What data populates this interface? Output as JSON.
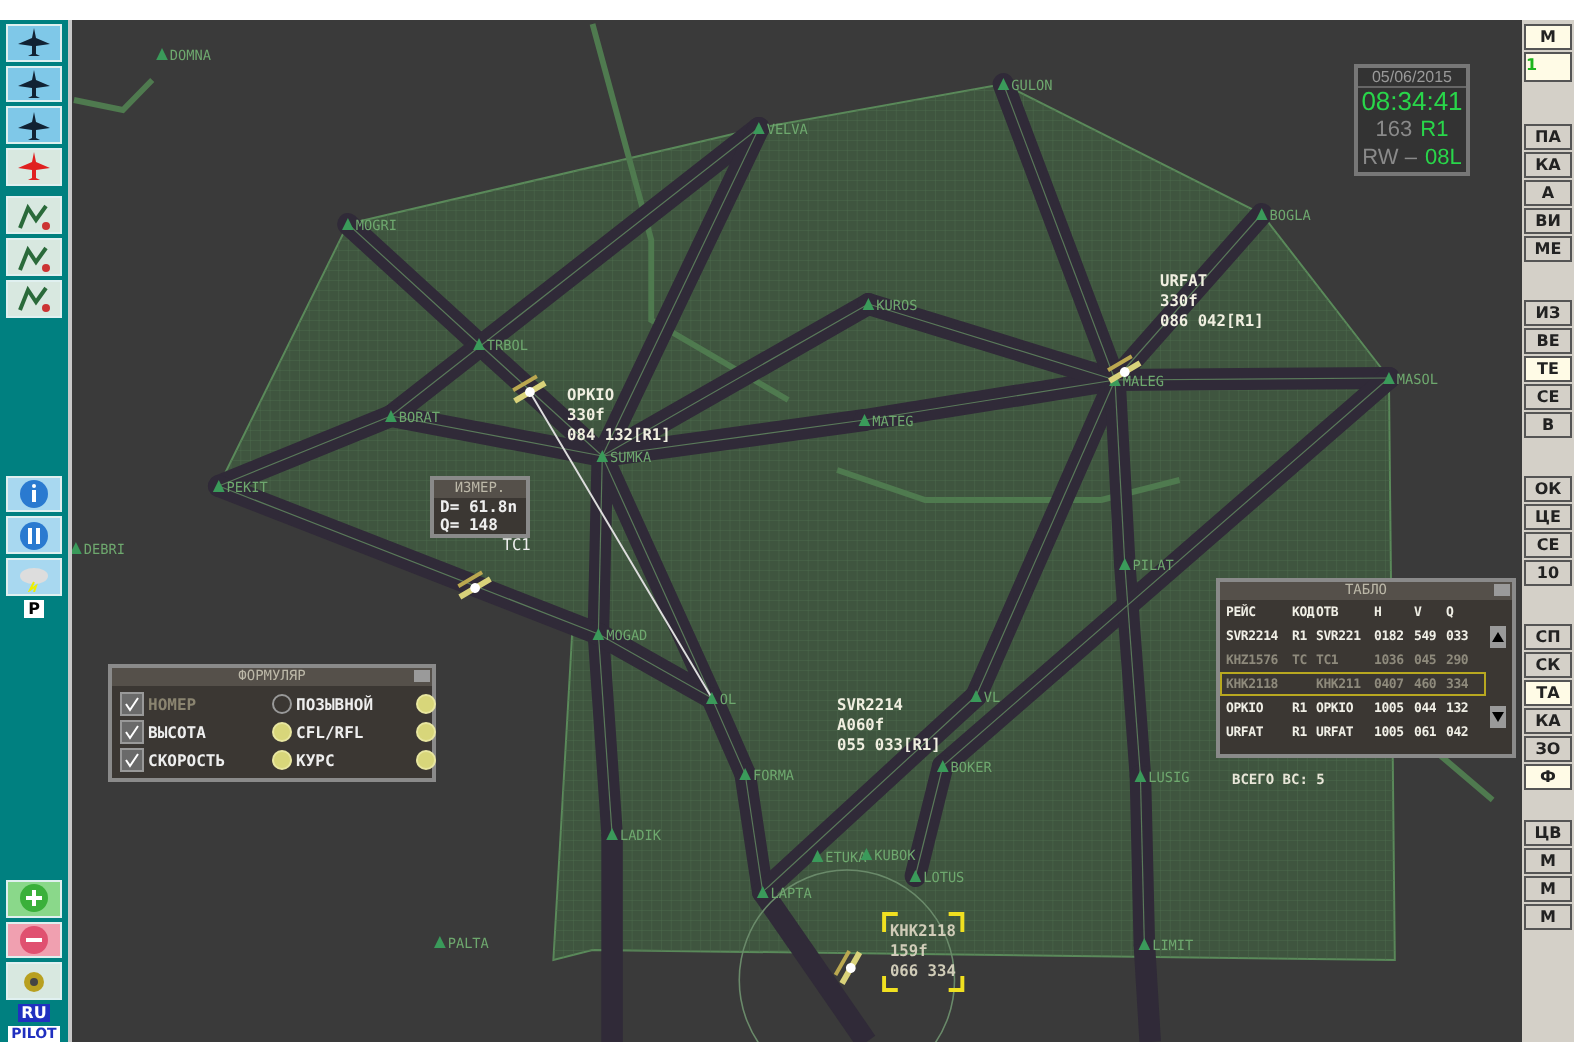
{
  "toolbar": {
    "weather_label": "P",
    "language": "RU",
    "pilot": "PILOT"
  },
  "map": {
    "waypoints": [
      "DOMNA",
      "VELVA",
      "MOGRI",
      "GULON",
      "BOGLA",
      "KUROS",
      "TRBOL",
      "BORAT",
      "MALEG",
      "MATEG",
      "MASOL",
      "SUMKA",
      "PEKIT",
      "DEBRI",
      "PILAT",
      "MOGAD",
      "OL",
      "VL",
      "FORMA",
      "BOKER",
      "LUSIG",
      "LADIK",
      "ETUKA",
      "KUBOK",
      "LOTUS",
      "LAPTA",
      "PALTA",
      "LIMIT"
    ],
    "flights": [
      {
        "callsign": "OPKIO",
        "level": "330f",
        "vector": "084 132[R1]",
        "selected": false
      },
      {
        "callsign": "URFAT",
        "level": "330f",
        "vector": "086 042[R1]",
        "selected": false
      },
      {
        "callsign": "SVR2214",
        "level": "A060f",
        "vector": "055 033[R1]",
        "selected": false
      },
      {
        "callsign": "KHK2118",
        "level": "159f",
        "vector": "066 334",
        "selected": true
      }
    ],
    "track_label": "TC1"
  },
  "measure": {
    "title": "ИЗМЕР.",
    "distance": "D= 61.8n",
    "bearing": "Q= 148"
  },
  "clock": {
    "date": "05/06/2015",
    "time": "08:34:41",
    "code": "163",
    "route": "R1",
    "runway_label": "RW –",
    "runway": "08L"
  },
  "formular": {
    "title": "ФОРМУЛЯР",
    "options": [
      {
        "kind": "check",
        "label": "НОМЕР",
        "checked": true,
        "disabled": true,
        "on": false
      },
      {
        "kind": "plain",
        "label": "ПОЗЫВНОЙ",
        "on": true
      },
      {
        "kind": "check",
        "label": "ВЫСОТА",
        "checked": true,
        "disabled": false,
        "on": true
      },
      {
        "kind": "plain",
        "label": "CFL/RFL",
        "on": true
      },
      {
        "kind": "check",
        "label": "СКОРОСТЬ",
        "checked": true,
        "disabled": false,
        "on": true
      },
      {
        "kind": "plain",
        "label": "КУРС",
        "on": true
      }
    ]
  },
  "tablo": {
    "title": "ТАБЛО",
    "columns": [
      "РЕЙС",
      "КОД",
      "ОТВ",
      "H",
      "V",
      "Q"
    ],
    "rows": [
      {
        "cells": [
          "SVR2214",
          "R1",
          "SVR221",
          "0182",
          "549",
          "033"
        ],
        "dimmed": false,
        "selected": false
      },
      {
        "cells": [
          "KHZ1576",
          "TC",
          "TC1",
          "1036",
          "045",
          "290"
        ],
        "dimmed": true,
        "selected": false
      },
      {
        "cells": [
          "KHK2118",
          "",
          "KHK211",
          "0407",
          "460",
          "334"
        ],
        "dimmed": true,
        "selected": true
      },
      {
        "cells": [
          "OPKIO",
          "R1",
          "OPKIO",
          "1005",
          "044",
          "132"
        ],
        "dimmed": false,
        "selected": false
      },
      {
        "cells": [
          "URFAT",
          "R1",
          "URFAT",
          "1005",
          "061",
          "042"
        ],
        "dimmed": false,
        "selected": false
      }
    ],
    "total": "ВСЕГО ВС: 5"
  },
  "side_panel": {
    "items": [
      {
        "kind": "button",
        "label": "М",
        "selected": true
      },
      {
        "kind": "value",
        "label": "1",
        "selected": true
      },
      {
        "kind": "button",
        "label": "ПА",
        "selected": false
      },
      {
        "kind": "button",
        "label": "КА",
        "selected": false
      },
      {
        "kind": "button",
        "label": "А",
        "selected": false
      },
      {
        "kind": "button",
        "label": "ВИ",
        "selected": false
      },
      {
        "kind": "button",
        "label": "МЕ",
        "selected": false
      },
      {
        "kind": "button",
        "label": "ИЗ",
        "selected": false
      },
      {
        "kind": "button",
        "label": "ВЕ",
        "selected": false
      },
      {
        "kind": "button",
        "label": "ТЕ",
        "selected": true
      },
      {
        "kind": "button",
        "label": "СЕ",
        "selected": false
      },
      {
        "kind": "button",
        "label": "В",
        "selected": false
      },
      {
        "kind": "button",
        "label": "ОК",
        "selected": false
      },
      {
        "kind": "button",
        "label": "ЦЕ",
        "selected": false
      },
      {
        "kind": "button",
        "label": "СЕ",
        "selected": false
      },
      {
        "kind": "button",
        "label": "10",
        "selected": false
      },
      {
        "kind": "button",
        "label": "СП",
        "selected": false
      },
      {
        "kind": "button",
        "label": "СК",
        "selected": false
      },
      {
        "kind": "button",
        "label": "ТА",
        "selected": true
      },
      {
        "kind": "button",
        "label": "КА",
        "selected": false
      },
      {
        "kind": "button",
        "label": "ЗО",
        "selected": false
      },
      {
        "kind": "button",
        "label": "Ф",
        "selected": true
      },
      {
        "kind": "button",
        "label": "ЦВ",
        "selected": false
      },
      {
        "kind": "button",
        "label": "М",
        "selected": false
      },
      {
        "kind": "button",
        "label": "М",
        "selected": false
      },
      {
        "kind": "button",
        "label": "М",
        "selected": false
      }
    ]
  }
}
